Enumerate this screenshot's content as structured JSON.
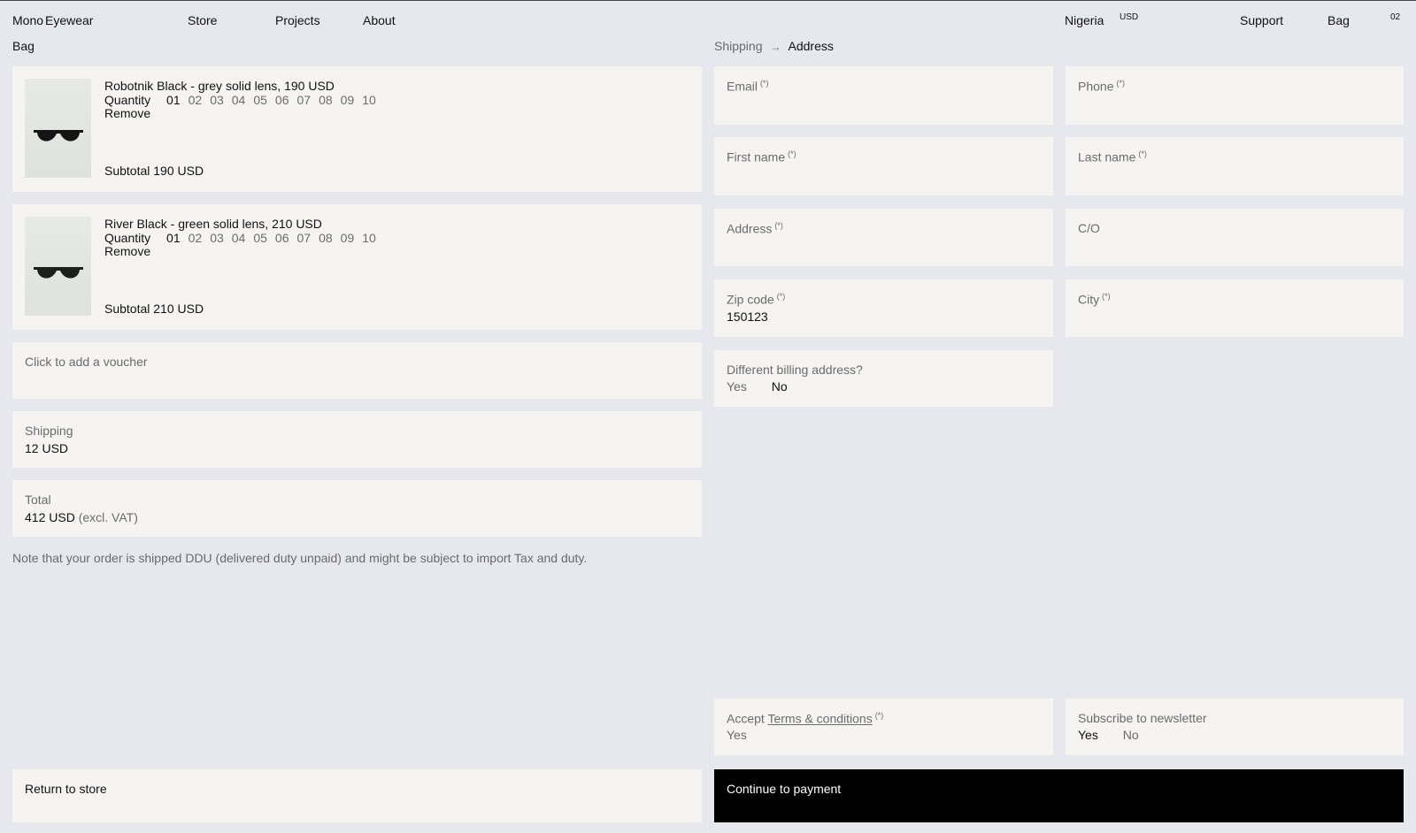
{
  "nav": {
    "brand": "Mono Eyewear",
    "brand_part1": "Mono",
    "brand_part2": "Eyewear",
    "store": "Store",
    "projects": "Projects",
    "about": "About",
    "country": "Nigeria",
    "currency": "USD",
    "support": "Support",
    "bag": "Bag",
    "bag_count": "02"
  },
  "left": {
    "heading": "Bag",
    "items": [
      {
        "name": "Robotnik Black - grey solid lens, 190 USD",
        "quantity_label": "Quantity",
        "quantities": [
          "01",
          "02",
          "03",
          "04",
          "05",
          "06",
          "07",
          "08",
          "09",
          "10"
        ],
        "selected_quantity": "01",
        "remove": "Remove",
        "subtotal": "Subtotal 190 USD",
        "icon": "sunglasses-thumbnail"
      },
      {
        "name": "River Black - green solid lens, 210 USD",
        "quantity_label": "Quantity",
        "quantities": [
          "01",
          "02",
          "03",
          "04",
          "05",
          "06",
          "07",
          "08",
          "09",
          "10"
        ],
        "selected_quantity": "01",
        "remove": "Remove",
        "subtotal": "Subtotal 210 USD",
        "icon": "sunglasses-thumbnail"
      }
    ],
    "voucher": "Click to add a voucher",
    "shipping_label": "Shipping",
    "shipping_value": "12 USD",
    "total_label": "Total",
    "total_value": "412 USD",
    "total_note": "(excl. VAT)",
    "note": "Note that your order is shipped DDU (delivered duty unpaid) and might be subject to import Tax and duty.",
    "return": "Return to store"
  },
  "right": {
    "breadcrumb_step1": "Shipping",
    "breadcrumb_arrow": "→",
    "breadcrumb_step2": "Address",
    "required_mark": "(*)",
    "fields": {
      "email": {
        "label": "Email",
        "value": ""
      },
      "phone": {
        "label": "Phone",
        "value": ""
      },
      "first_name": {
        "label": "First name",
        "value": ""
      },
      "last_name": {
        "label": "Last name",
        "value": ""
      },
      "address": {
        "label": "Address",
        "value": ""
      },
      "co": {
        "label": "C/O",
        "value": ""
      },
      "zip": {
        "label": "Zip code",
        "value": "150123"
      },
      "city": {
        "label": "City",
        "value": ""
      }
    },
    "billing_label": "Different billing address?",
    "billing_yes": "Yes",
    "billing_no": "No",
    "accept_prefix": "Accept",
    "accept_link": "Terms & conditions",
    "accept_yes": "Yes",
    "newsletter_label": "Subscribe to newsletter",
    "newsletter_yes": "Yes",
    "newsletter_no": "No",
    "continue": "Continue to payment"
  },
  "colors": {
    "background": "#e6e8ee",
    "card": "#f5f4f2",
    "primary_button": "#000000",
    "muted_text": "#6b6b6b"
  }
}
